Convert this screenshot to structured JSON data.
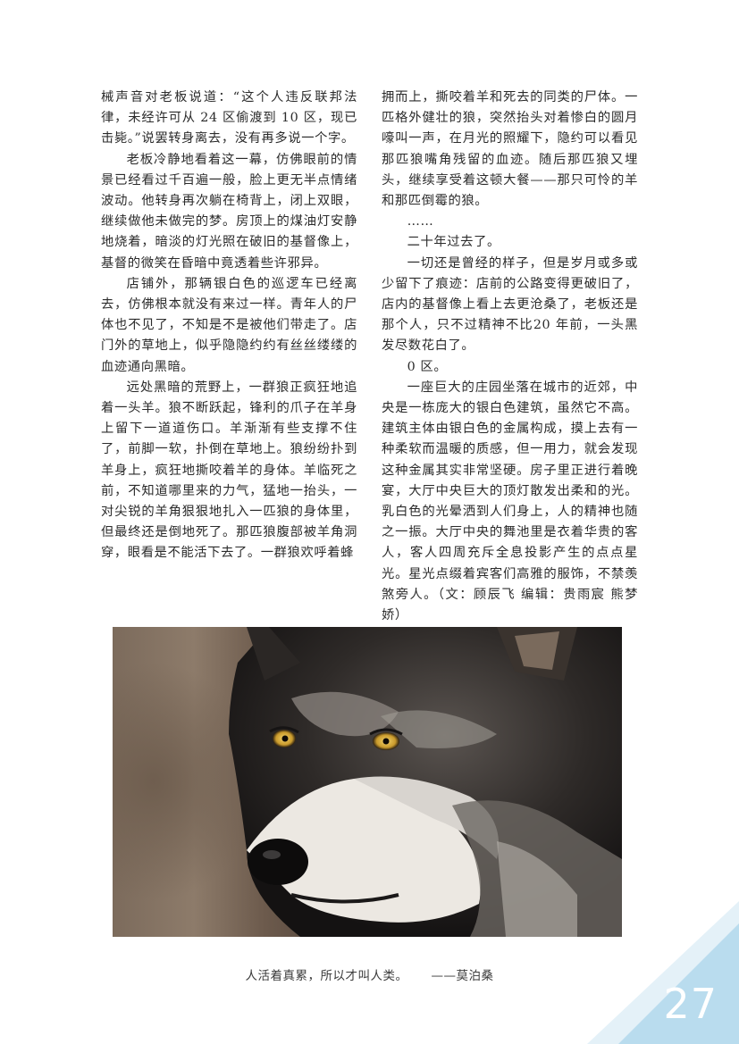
{
  "left_column": [
    {
      "text": "械声音对老板说道：“这个人违反联邦法律，未经许可从 24 区偷渡到 10 区，现已击毙。”说罢转身离去，没有再多说一个字。",
      "indent": false
    },
    {
      "text": "老板冷静地看着这一幕，仿佛眼前的情景已经看过千百遍一般，脸上更无半点情绪波动。他转身再次躺在椅背上，闭上双眼，继续做他未做完的梦。房顶上的煤油灯安静地烧着，暗淡的灯光照在破旧的基督像上，基督的微笑在昏暗中竟透着些许邪异。",
      "indent": true
    },
    {
      "text": "店铺外，那辆银白色的巡逻车已经离去，仿佛根本就没有来过一样。青年人的尸体也不见了，不知是不是被他们带走了。店门外的草地上，似乎隐隐约约有丝丝缕缕的血迹通向黑暗。",
      "indent": true
    },
    {
      "text": "远处黑暗的荒野上，一群狼正疯狂地追着一头羊。狼不断跃起，锋利的爪子在羊身上留下一道道伤口。羊渐渐有些支撑不住了，前脚一软，扑倒在草地上。狼纷纷扑到羊身上，疯狂地撕咬着羊的身体。羊临死之前，不知道哪里来的力气，猛地一抬头，一对尖锐的羊角狠狠地扎入一匹狼的身体里，但最终还是倒地死了。那匹狼腹部被羊角洞穿，眼看是不能活下去了。一群狼欢呼着蜂",
      "indent": true
    }
  ],
  "right_column": [
    {
      "text": "拥而上，撕咬着羊和死去的同类的尸体。一匹格外健壮的狼，突然抬头对着惨白的圆月嚎叫一声，在月光的照耀下，隐约可以看见那匹狼嘴角残留的血迹。随后那匹狼又埋头，继续享受着这顿大餐——那只可怜的羊和那匹倒霉的狼。",
      "indent": false
    },
    {
      "text": "……",
      "indent": true
    },
    {
      "text": "二十年过去了。",
      "indent": true
    },
    {
      "text": "一切还是曾经的样子，但是岁月或多或少留下了痕迹：店前的公路变得更破旧了，店内的基督像上看上去更沧桑了，老板还是那个人，只不过精神不比20 年前，一头黑发尽数花白了。",
      "indent": true
    },
    {
      "text": "0 区。",
      "indent": true
    },
    {
      "text": "一座巨大的庄园坐落在城市的近郊，中央是一栋庞大的银白色建筑，虽然它不高。建筑主体由银白色的金属构成，摸上去有一种柔软而温暖的质感，但一用力，就会发现这种金属其实非常坚硬。房子里正进行着晚宴，大厅中央巨大的顶灯散发出柔和的光。乳白色的光晕洒到人们身上，人的精神也随之一振。大厅中央的舞池里是衣着华贵的客人，客人四周充斥全息投影产生的点点星光。星光点缀着宾客们高雅的服饰，不禁羡煞旁人。（文：顾辰飞 编辑：贵雨宸 熊梦娇）",
      "indent": true
    }
  ],
  "quote": {
    "text": "人活着真累，所以才叫人类。",
    "author": "——莫泊桑"
  },
  "page_number": "27",
  "colors": {
    "corner_light": "#e4f1f8",
    "corner_main": "#b9dcee"
  }
}
